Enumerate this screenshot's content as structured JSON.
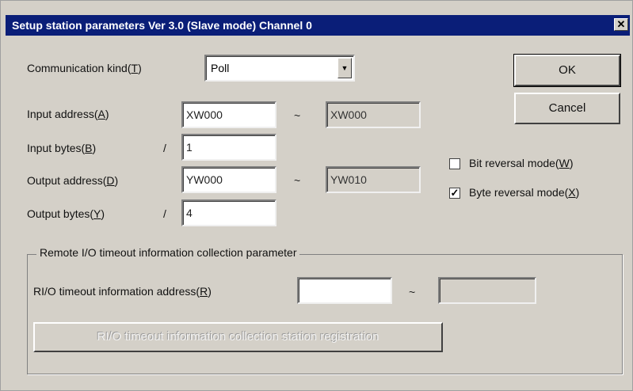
{
  "window": {
    "title": "Setup station parameters Ver 3.0 (Slave mode) Channel 0",
    "close_glyph": "✕"
  },
  "comm": {
    "label_prefix": "Communication kind(",
    "label_key": "T",
    "label_suffix": ")",
    "value": "Poll",
    "arrow_glyph": "▼"
  },
  "input_address": {
    "label_prefix": "Input address(",
    "label_key": "A",
    "label_suffix": ")",
    "value": "XW000",
    "tilde": "~",
    "end_value": "XW000"
  },
  "input_bytes": {
    "label_prefix": "Input bytes(",
    "label_key": "B",
    "label_suffix": ")",
    "slash": "/",
    "value": "1"
  },
  "output_address": {
    "label_prefix": "Output address(",
    "label_key": "D",
    "label_suffix": ")",
    "value": "YW000",
    "tilde": "~",
    "end_value": "YW010"
  },
  "output_bytes": {
    "label_prefix": "Output bytes(",
    "label_key": "Y",
    "label_suffix": ")",
    "slash": "/",
    "value": "4"
  },
  "buttons": {
    "ok": "OK",
    "cancel": "Cancel"
  },
  "options": {
    "bit_reversal": {
      "label_prefix": "Bit reversal mode(",
      "label_key": "W",
      "label_suffix": ")",
      "checked": false,
      "mark": ""
    },
    "byte_reversal": {
      "label_prefix": "Byte reversal mode(",
      "label_key": "X",
      "label_suffix": ")",
      "checked": true,
      "mark": "✓"
    }
  },
  "remote": {
    "group_title": "Remote I/O timeout information collection parameter",
    "address_label_prefix": "RI/O timeout information address(",
    "address_label_key": "R",
    "address_label_suffix": ")",
    "address_value": "",
    "tilde": "~",
    "end_value": "",
    "registration_button": "RI/O timeout information collection station registration"
  }
}
